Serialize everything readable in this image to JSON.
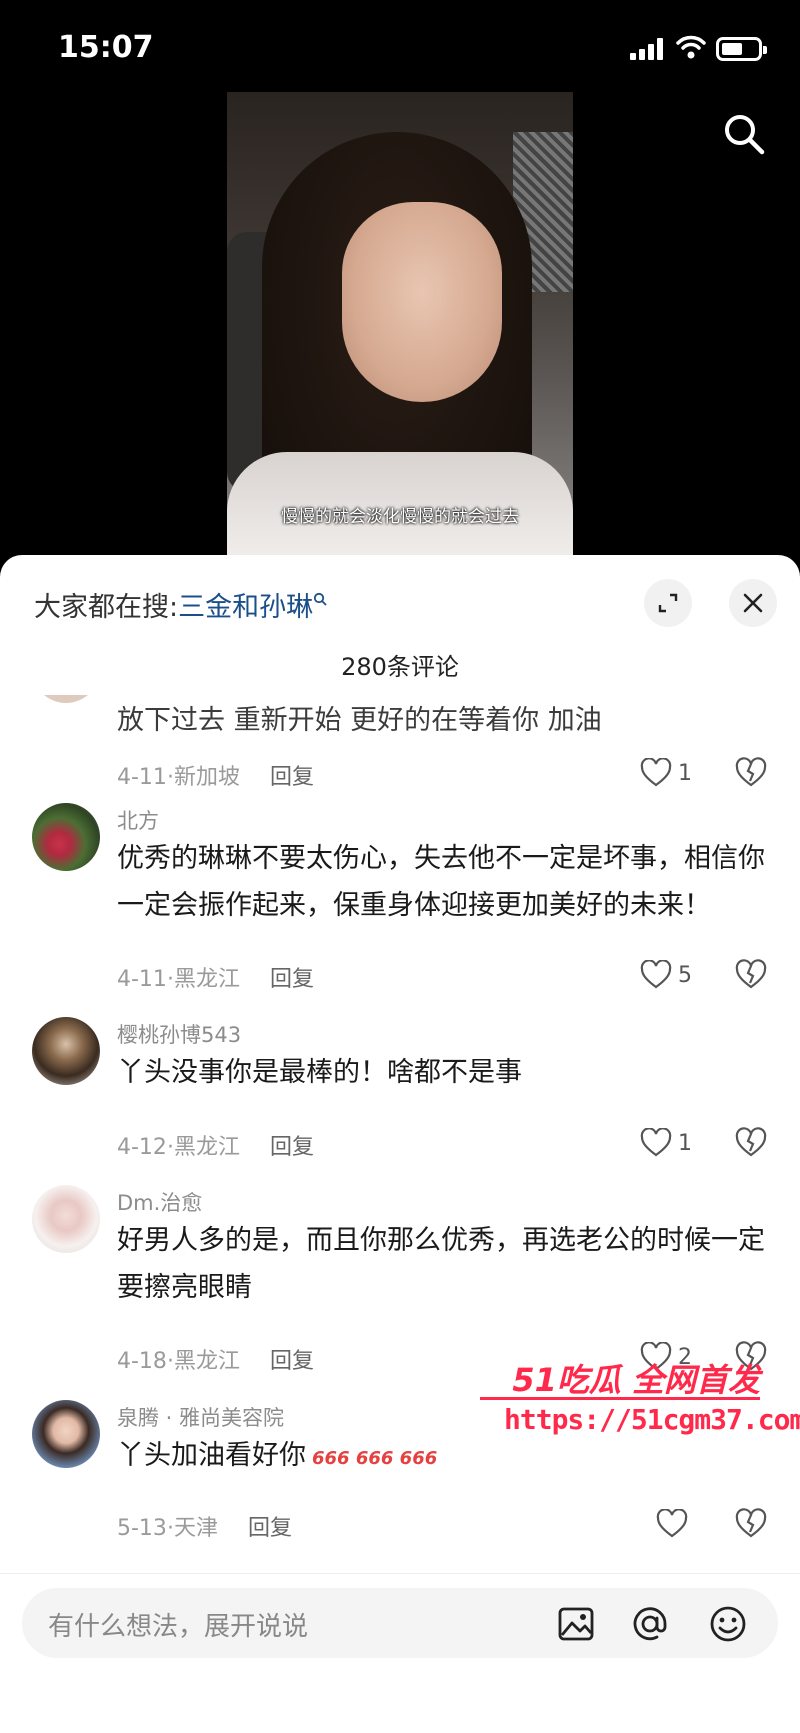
{
  "status_bar": {
    "time": "15:07"
  },
  "video": {
    "caption": "慢慢的就会淡化慢慢的就会过去"
  },
  "sheet": {
    "hot_search_prefix": "大家都在搜:",
    "hot_search_keyword": "三金和孙琳",
    "comment_count": "280条评论"
  },
  "comments": [
    {
      "text": "放下过去 重新开始 更好的在等着你 加油",
      "date": "4-11",
      "location": "新加坡",
      "reply": "回复",
      "likes": "1"
    },
    {
      "user": "北方",
      "text": "优秀的琳琳不要太伤心，失去他不一定是坏事，相信你一定会振作起来，保重身体迎接更加美好的未来！",
      "date": "4-11",
      "location": "黑龙江",
      "reply": "回复",
      "likes": "5"
    },
    {
      "user": "樱桃孙博543",
      "text": "丫头没事你是最棒的！啥都不是事",
      "date": "4-12",
      "location": "黑龙江",
      "reply": "回复",
      "likes": "1"
    },
    {
      "user": "Dm.治愈",
      "text": "好男人多的是，而且你那么优秀，再选老公的时候一定要擦亮眼睛",
      "date": "4-18",
      "location": "黑龙江",
      "reply": "回复",
      "likes": "2"
    },
    {
      "user": "泉腾 · 雅尚美容院",
      "text": "丫头加油看好你",
      "emoji": "666 666 666",
      "date": "5-13",
      "location": "天津",
      "reply": "回复",
      "likes": ""
    }
  ],
  "watermark": {
    "title": "51吃瓜 全网首发",
    "url": "https://51cgm37.com"
  },
  "input": {
    "placeholder": "有什么想法，展开说说"
  },
  "icons": [
    "search-icon",
    "expand-icon",
    "close-icon",
    "heart-icon",
    "broken-heart-icon",
    "image-icon",
    "at-icon",
    "emoji-icon"
  ],
  "colors": {
    "keyword": "#1b4f8a",
    "watermark": "#ff2a4b",
    "emoji_666": "#e64141"
  }
}
